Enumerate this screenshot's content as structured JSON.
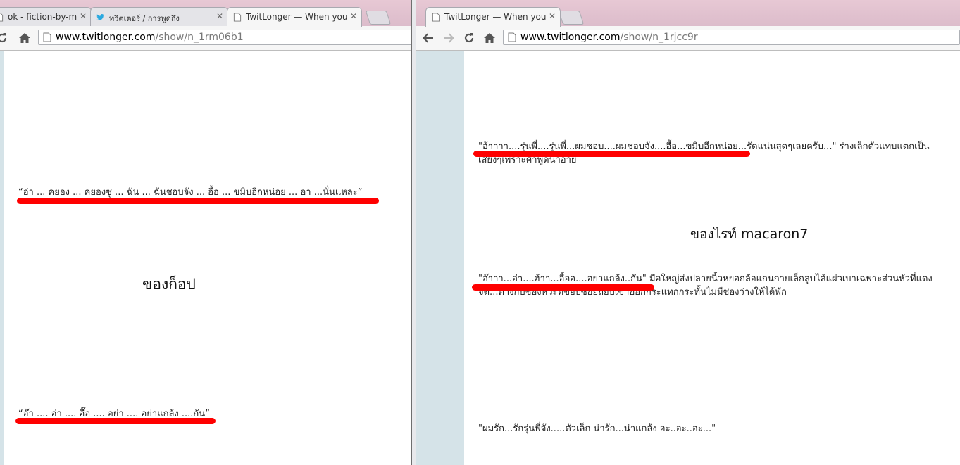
{
  "left_window": {
    "tabs": [
      {
        "title": "ok - fiction-by-mac",
        "icon": "page-icon"
      },
      {
        "title": "ทวิตเตอร์ / การพูดถึง",
        "icon": "twitter-icon"
      },
      {
        "title": "TwitLonger — When you t",
        "icon": "page-icon"
      }
    ],
    "url_host": "www.twitlonger.com",
    "url_path": "/show/n_1rm06b1",
    "content": {
      "quote1": "“อ่า ... คยอง ... คยองซู ... ฉัน ... ฉันชอบจัง ... อื้อ ... ขมิบอีกหน่อย ... อา ...นั่นแหละ”",
      "heading": "ของก็อป",
      "quote2": "“อ๊า .... อ่า .... อื๊อ .... อย่า .... อย่าแกล้ง ....กัน”"
    }
  },
  "right_window": {
    "tabs": [
      {
        "title": "TwitLonger — When you t",
        "icon": "page-icon"
      }
    ],
    "url_host": "www.twitlonger.com",
    "url_path": "/show/n_1rjcc9r",
    "content": {
      "para1": "\"อ้าาาา....รุ่นพี่....รุ่นพี่...ผมชอบ....ผมชอบจัง....อื้อ...ขมิบอีกหน่อย...รัดแน่นสุดๆเลยครับ...\" ร่างเล็กตัวแทบแตกเป็นเสี่ยงๆเพราะคำพูดนาอาย",
      "heading": "ของไรท์ macaron7",
      "para2": "\"อ๊าาา...อ่า....ฮ้าา...อื้ออ....อย่าแกล้ง..กัน\" มือใหญ่ส่งปลายนิ้วหยอกล้อแกนกายเล็กลูบไล้แผ่วเบาเฉพาะส่วนหัวที่แดงจัด...ต่างกับช่องหวะที่ขยับซอยถี่ยิบเข้าออกกระแทกกระทั้นไม่มีช่องว่างให้ได้พัก",
      "para3": "\"ผมรัก...รักรุ่นพี่จัง.....ตัวเล็ก น่ารัก...น่าแกล้ง อะ..อะ..อะ...\""
    }
  },
  "colors": {
    "highlight": "#ff0000",
    "right_sidebar": "#d5e3e8",
    "tabstrip": "#e2c3d0"
  }
}
